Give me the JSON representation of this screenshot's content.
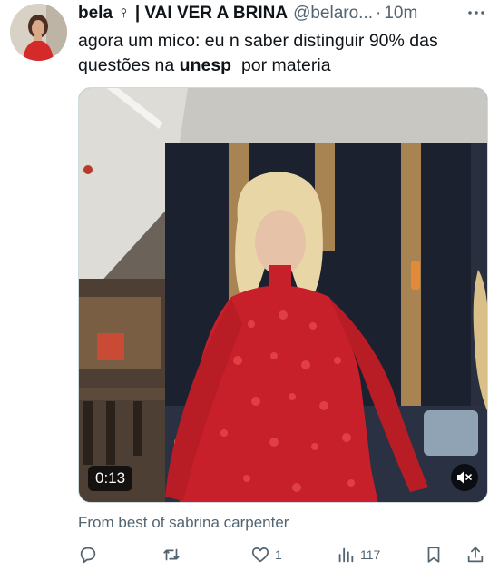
{
  "tweet": {
    "display_name": "bela ♀ | VAI VER A BRINA",
    "handle": "@belaro...",
    "separator": "·",
    "time": "10m",
    "text_part1": "agora um mico: eu n saber distinguir 90% das questões na ",
    "text_bold": "unesp",
    "text_part2": "  por materia",
    "video_duration": "0:13",
    "source": "From best of sabrina carpenter"
  },
  "actions": {
    "reply": {
      "icon": "reply-icon"
    },
    "retweet": {
      "icon": "retweet-icon"
    },
    "like": {
      "icon": "heart-icon",
      "count": "1"
    },
    "views": {
      "icon": "views-icon",
      "count": "117"
    },
    "bookmark": {
      "icon": "bookmark-icon"
    },
    "share": {
      "icon": "share-icon"
    }
  },
  "colors": {
    "text_primary": "#0f1419",
    "text_secondary": "#536471",
    "dress_red": "#c8202a"
  }
}
